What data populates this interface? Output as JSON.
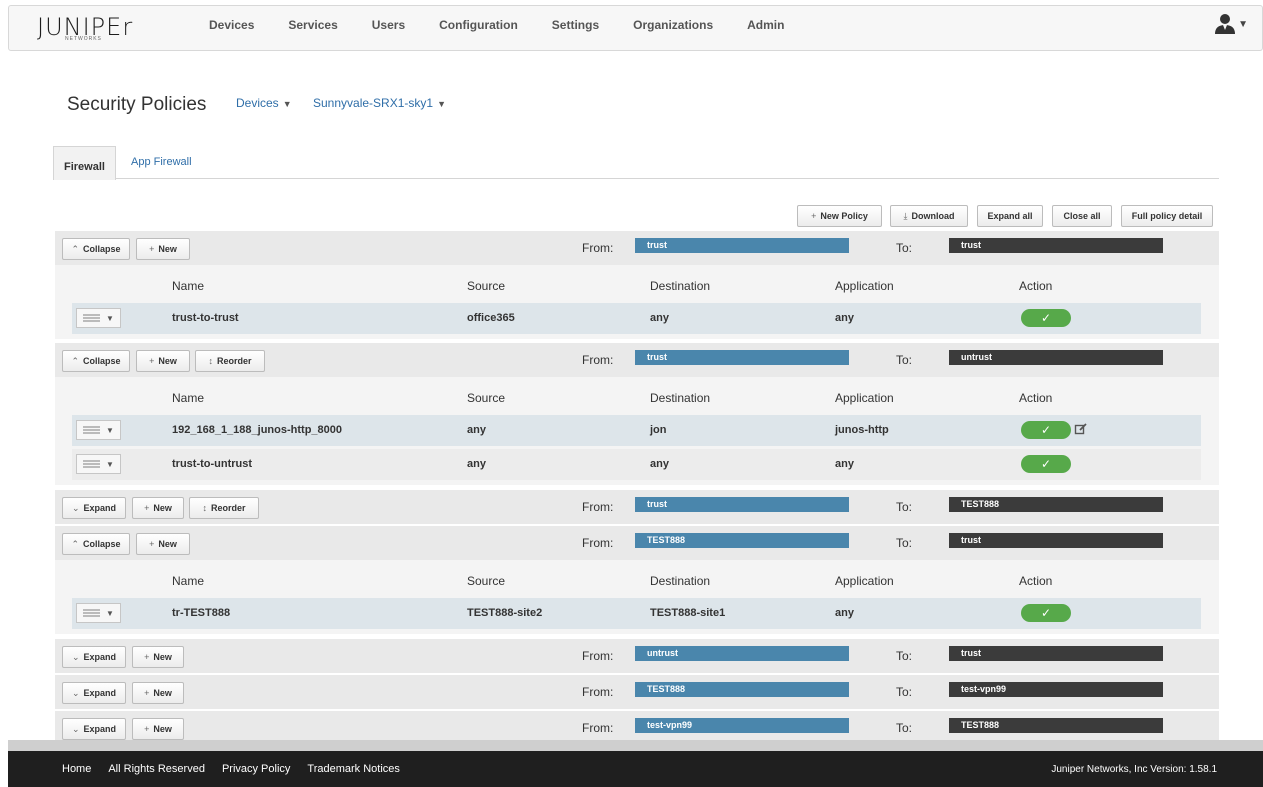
{
  "header": {
    "logo": "JUNIPEr",
    "logo_sub": "NETWORKS",
    "nav": [
      "Devices",
      "Services",
      "Users",
      "Configuration",
      "Settings",
      "Organizations",
      "Admin"
    ]
  },
  "page": {
    "title": "Security Policies",
    "device_filter": "Devices",
    "device_name": "Sunnyvale-SRX1-sky1"
  },
  "tabs": [
    "Firewall",
    "App Firewall"
  ],
  "toolbar": {
    "new_policy": "New Policy",
    "download": "Download",
    "expand_all": "Expand all",
    "close_all": "Close all",
    "full_policy_detail": "Full policy detail"
  },
  "labels": {
    "from": "From:",
    "to": "To:",
    "collapse": "Collapse",
    "expand": "Expand",
    "new": "New",
    "reorder": "Reorder",
    "check": "✓"
  },
  "columns": [
    "Name",
    "Source",
    "Destination",
    "Application",
    "Action"
  ],
  "zone_pairs": [
    {
      "from": "trust",
      "to": "trust",
      "expanded": true,
      "reorder": false,
      "policies": [
        {
          "name": "trust-to-trust",
          "source": "office365",
          "destination": "any",
          "application": "any",
          "action": "permit"
        }
      ]
    },
    {
      "from": "trust",
      "to": "untrust",
      "expanded": true,
      "reorder": true,
      "policies": [
        {
          "name": "192_168_1_188_junos-http_8000",
          "source": "any",
          "destination": "jon",
          "application": "junos-http",
          "action": "permit"
        },
        {
          "name": "trust-to-untrust",
          "source": "any",
          "destination": "any",
          "application": "any",
          "action": "permit"
        }
      ]
    },
    {
      "from": "trust",
      "to": "TEST888",
      "expanded": false,
      "reorder": true
    },
    {
      "from": "TEST888",
      "to": "trust",
      "expanded": true,
      "reorder": false,
      "policies": [
        {
          "name": "tr-TEST888",
          "source": "TEST888-site2",
          "destination": "TEST888-site1",
          "application": "any",
          "action": "permit"
        }
      ]
    },
    {
      "from": "untrust",
      "to": "trust",
      "expanded": false,
      "reorder": false
    },
    {
      "from": "TEST888",
      "to": "test-vpn99",
      "expanded": false,
      "reorder": false
    },
    {
      "from": "test-vpn99",
      "to": "TEST888",
      "expanded": false,
      "reorder": false
    }
  ],
  "footer": {
    "links": [
      "Home",
      "All Rights Reserved",
      "Privacy Policy",
      "Trademark Notices"
    ],
    "version": "Juniper Networks, Inc Version: 1.58.1"
  },
  "colors": {
    "from_pill": "#4a86ac",
    "to_pill": "#3b3b3b",
    "permit": "#57a94a",
    "link": "#2f6ea8"
  }
}
